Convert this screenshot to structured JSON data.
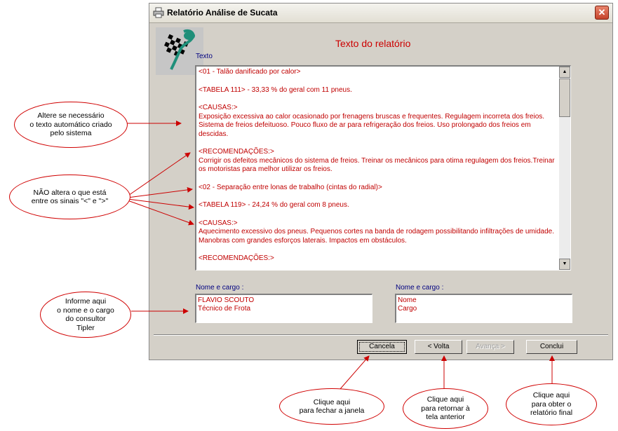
{
  "window": {
    "title": "Relatório Análise de Sucata",
    "close_label": "✕"
  },
  "report": {
    "heading": "Texto do relatório",
    "text_label": "Texto",
    "paragraphs": [
      "<01 - Talão danificado por calor>",
      "<TABELA 111> - 33,33 %  do geral com 11 pneus.",
      "<CAUSAS:>\nExposição excessiva ao calor  ocasionado por frenagens bruscas e frequentes. Regulagem incorreta dos freios. Sistema de freios  defeituoso. Pouco fluxo de ar para refrigeração dos freios. Uso prolongado dos freios em descidas.",
      "<RECOMENDAÇÕES:>\nCorrigir os defeitos mecânicos do sistema de freios. Treinar os mecânicos para otima regulagem dos freios.Treinar os motoristas para melhor utilizar os freios.",
      "<02 - Separação entre lonas de trabalho (cintas do radial)>",
      "<TABELA 119> - 24,24 %  do geral com 8 pneus.",
      "<CAUSAS:>\nAquecimento excessivo dos pneus. Pequenos cortes na banda de rodagem possibilitando infiltrações de umidade. Manobras com grandes esforços laterais. Impactos em obstáculos.",
      "<RECOMENDAÇÕES:>"
    ]
  },
  "consultant": {
    "left_label": "Nome e cargo :",
    "left_name": "FLAVIO SCOUTO",
    "left_role": "Técnico de Frota",
    "right_label": "Nome e cargo :",
    "right_name": "Nome",
    "right_role": "Cargo"
  },
  "buttons": {
    "cancel": "Cancela",
    "back": "< Volta",
    "next": "Avança >",
    "finish": "Conclui"
  },
  "callouts": {
    "edit_text": "Altere se necessário\no texto automático criado\npelo sistema",
    "no_change": "NÃO altera o que está\nentre os sinais \"<\" e \">\"",
    "inform": "Informe aqui\no nome e o cargo\ndo consultor\nTipler",
    "close": "Clique aqui\npara fechar a janela",
    "back": "Clique aqui\npara retornar à\ntela anterior",
    "final": "Clique aqui\npara obter o\nrelatório final"
  },
  "colors": {
    "accent_red": "#cc0000",
    "window_bg": "#d4d0c8",
    "label_blue": "#000080"
  }
}
